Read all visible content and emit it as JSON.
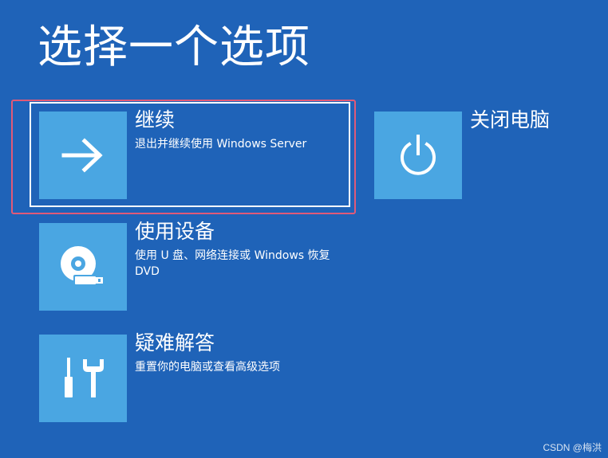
{
  "screen": {
    "title": "选择一个选项"
  },
  "options": {
    "continue": {
      "title": "继续",
      "description": "退出并继续使用 Windows Server",
      "icon": "arrow-right-icon"
    },
    "shutdown": {
      "title": "关闭电脑",
      "icon": "power-icon"
    },
    "use_device": {
      "title": "使用设备",
      "description": "使用 U 盘、网络连接或 Windows 恢复 DVD",
      "icon": "disc-usb-icon"
    },
    "troubleshoot": {
      "title": "疑难解答",
      "description": "重置你的电脑或查看高级选项",
      "icon": "tools-icon"
    }
  },
  "watermark": "CSDN @梅洪",
  "colors": {
    "background": "#1f63b8",
    "tile": "#4aa6e2",
    "highlight": "#e05a78",
    "text": "#ffffff"
  }
}
